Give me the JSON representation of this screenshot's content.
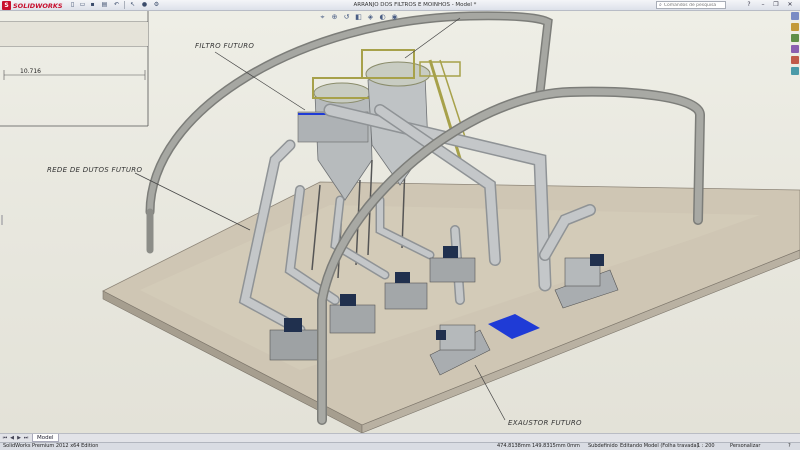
{
  "app": {
    "name": "SOLIDWORKS",
    "badge": "S"
  },
  "document": {
    "title": "ARRANJO DOS FILTROS E MOINHOS - Model *"
  },
  "search": {
    "placeholder": "Comandos de pesquisa"
  },
  "toolbar": {
    "icons": [
      "new-icon",
      "open-icon",
      "save-icon",
      "print-icon",
      "undo-icon",
      "select-icon",
      "rebuild-icon",
      "options-icon"
    ]
  },
  "view_toolbar": {
    "icons": [
      "zoom-fit-icon",
      "zoom-area-icon",
      "previous-view-icon",
      "section-view-icon",
      "view-orientation-icon",
      "display-style-icon",
      "hide-show-icon"
    ]
  },
  "annotations": {
    "filtro": "FILTRO FUTURO",
    "rede": "REDE DE DUTOS FUTURO",
    "exaustor": "EXAUSTOR FUTURO",
    "dimension": "10.716"
  },
  "tabs": {
    "model": "Model"
  },
  "status": {
    "edition": "SolidWorks Premium 2012 x64 Edition",
    "x": "474.8138mm",
    "y": "149.8315mm",
    "z": "0mm",
    "state": "Subdefinido",
    "editing": "Editando Model (Folha travada)",
    "scale": "1 : 200",
    "customize": "Personalizar"
  },
  "colors": {
    "steel": "#a9adb0",
    "frame": "#9a9b97",
    "floor": "#cfc6b4",
    "structure_green": "#a7a14a",
    "blue_panel": "#1f3bd6",
    "motor_blue": "#20304e"
  }
}
